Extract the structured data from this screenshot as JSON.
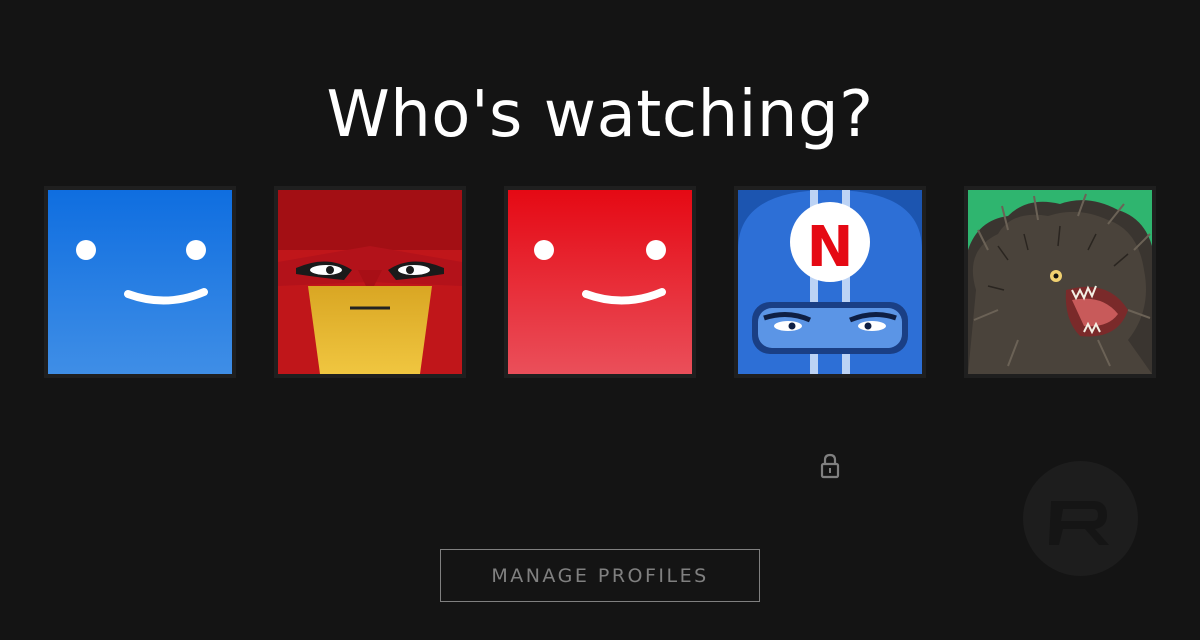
{
  "heading": "Who's watching?",
  "profiles": [
    {
      "avatar": "blue-smiley-avatar",
      "color": "#1a6fe0"
    },
    {
      "avatar": "red-yellow-grumpy-avatar",
      "color": "#d01c1c"
    },
    {
      "avatar": "red-smiley-avatar",
      "color": "#e50914"
    },
    {
      "avatar": "blue-netflix-helmet-avatar",
      "color": "#2a6fd6"
    },
    {
      "avatar": "furry-monster-avatar",
      "color": "#2fb56f"
    }
  ],
  "locked_profile_icon": "lock-icon",
  "manage_button": "MANAGE PROFILES",
  "helmet_letter": "N",
  "watermark_icon": "redmond-pie-logo"
}
